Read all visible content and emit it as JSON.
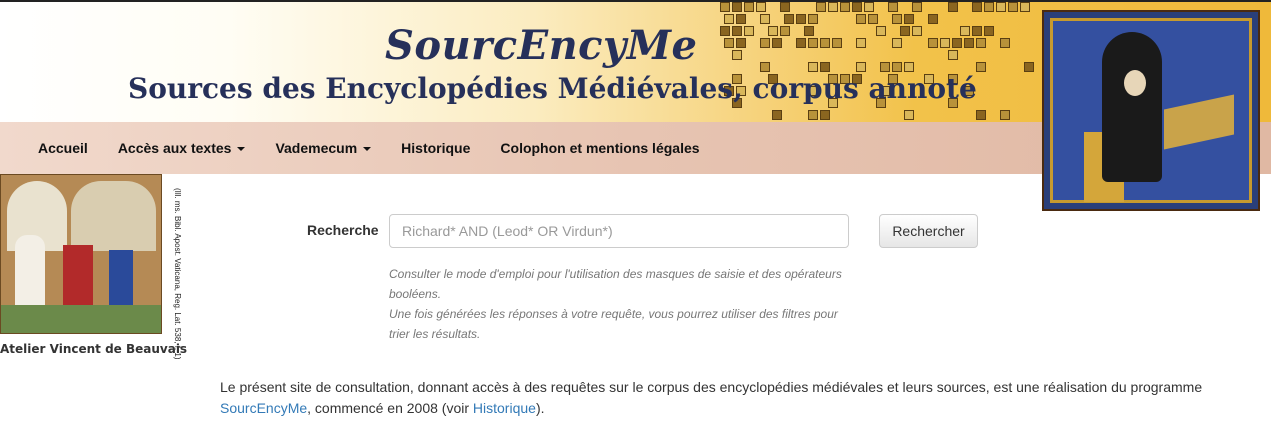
{
  "header": {
    "title": "SourcEncyMe",
    "subtitle": "Sources des Encyclopédies Médiévales, corpus annoté"
  },
  "nav": {
    "items": [
      {
        "label": "Accueil",
        "dropdown": false
      },
      {
        "label": "Accès aux textes",
        "dropdown": true
      },
      {
        "label": "Vademecum",
        "dropdown": true
      },
      {
        "label": "Historique",
        "dropdown": false
      },
      {
        "label": "Colophon et mentions légales",
        "dropdown": false
      }
    ]
  },
  "left_image": {
    "caption": "(Ill. ms. Bibl. Apost. Vaticana, Reg. Lat. 538, f. 1)",
    "atelier": "Atelier Vincent de Beauvais"
  },
  "search": {
    "label": "Recherche",
    "placeholder": "Richard* AND (Leod* OR Virdun*)",
    "value": "",
    "button_label": "Rechercher",
    "help_line1": "Consulter le mode d'emploi pour l'utilisation des masques de saisie et des opérateurs booléens.",
    "help_line2": "Une fois générées les réponses à votre requête, vous pourrez utiliser des filtres pour trier les résultats."
  },
  "intro": {
    "text_before": "Le présent site de consultation, donnant accès à des requêtes sur le corpus des encyclopédies médiévales et leurs sources, est une réalisation du programme ",
    "link1": "SourcEncyMe",
    "text_middle": ", commencé en 2008 (voir ",
    "link2": "Historique",
    "text_after": ")."
  },
  "colors": {
    "title": "#26305a",
    "nav_bg": "#e7c4b2",
    "link": "#337ab7"
  }
}
